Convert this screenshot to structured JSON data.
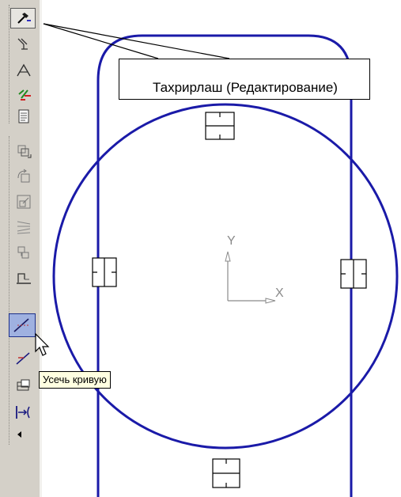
{
  "callout": {
    "text": "Тахрирлаш (Редактирование)"
  },
  "tooltip": {
    "text": "Усечь кривую"
  },
  "axes": {
    "x_label": "X",
    "y_label": "Y"
  },
  "colors": {
    "geometry": "#1a1aa8",
    "toolbar": "#d4d0c8",
    "active_button": "#9fb1e0",
    "tooltip_bg": "#ffffe1"
  },
  "toolbar": {
    "groups": [
      {
        "buttons": [
          "edit-icon",
          "dimensions-icon",
          "constraints-icon",
          "parameters-icon",
          "document-icon"
        ]
      },
      {
        "buttons": [
          "move-icon",
          "rotate-icon",
          "scale-icon",
          "symmetry-icon",
          "copy-icon",
          "deform-icon",
          "trim-curve-icon",
          "break-curve-icon",
          "trim-between-icon",
          "extend-icon"
        ]
      }
    ],
    "active_button": "trim-curve-icon"
  }
}
